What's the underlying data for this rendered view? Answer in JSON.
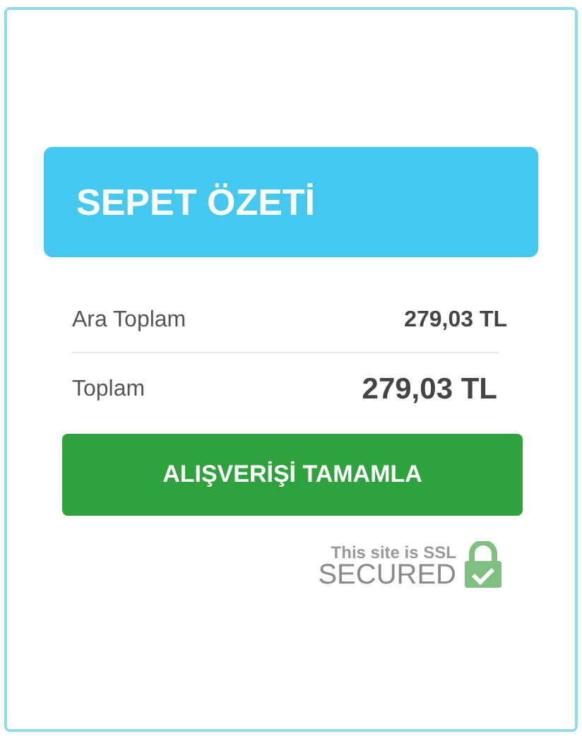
{
  "header": {
    "title": "SEPET ÖZETİ"
  },
  "rows": [
    {
      "kind": "subtotal",
      "label": "Ara Toplam",
      "value": "279,03 TL"
    },
    {
      "kind": "total",
      "label": "Toplam",
      "value": "279,03 TL"
    }
  ],
  "checkout_button": {
    "label": "ALIŞVERİŞİ TAMAMLA"
  },
  "ssl_badge": {
    "line_1": "This site is SSL",
    "line_2": "SECURED"
  }
}
